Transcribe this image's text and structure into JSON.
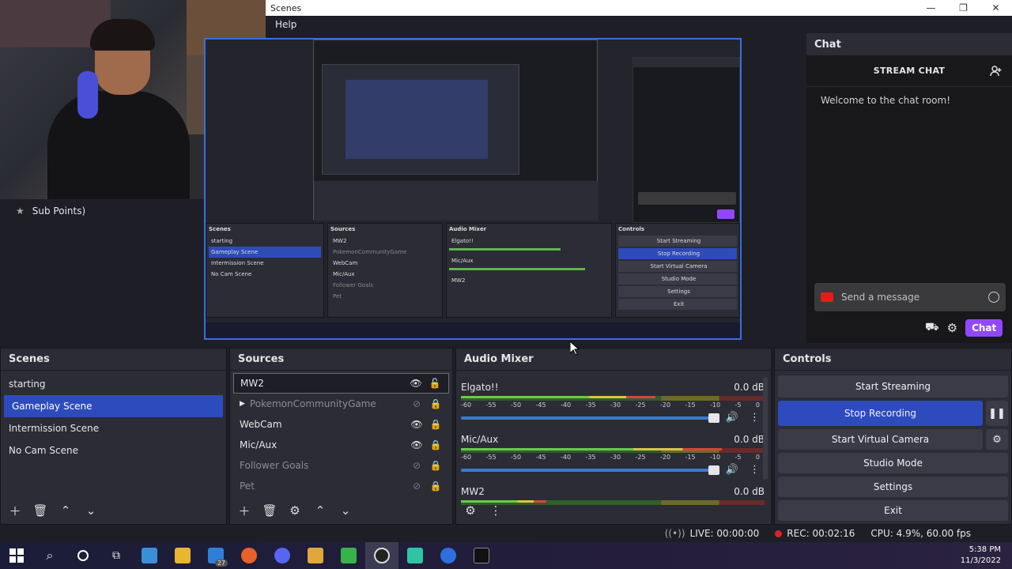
{
  "window": {
    "title": "Scenes",
    "menu_help": "Help"
  },
  "overlay": {
    "sub_points": "Sub Points)"
  },
  "chat": {
    "header": "Chat",
    "title": "STREAM CHAT",
    "welcome": "Welcome to the chat room!",
    "input_placeholder": "Send a message",
    "chat_button": "Chat"
  },
  "scenes": {
    "header": "Scenes",
    "items": [
      "starting",
      "Gameplay Scene",
      "Intermission Scene",
      "No Cam Scene"
    ],
    "selected_index": 1
  },
  "sources": {
    "header": "Sources",
    "items": [
      {
        "name": "MW2",
        "visible": true,
        "locked": false,
        "dim": false
      },
      {
        "name": "PokemonCommunityGame",
        "visible": false,
        "locked": true,
        "dim": true,
        "group": true
      },
      {
        "name": "WebCam",
        "visible": true,
        "locked": true,
        "dim": false
      },
      {
        "name": "Mic/Aux",
        "visible": true,
        "locked": true,
        "dim": false
      },
      {
        "name": "Follower Goals",
        "visible": false,
        "locked": true,
        "dim": true
      },
      {
        "name": "Pet",
        "visible": false,
        "locked": true,
        "dim": true
      }
    ]
  },
  "mixer": {
    "header": "Audio Mixer",
    "scale": [
      "-60",
      "-55",
      "-50",
      "-45",
      "-40",
      "-35",
      "-30",
      "-25",
      "-20",
      "-15",
      "-10",
      "-5",
      "0"
    ],
    "channels": [
      {
        "name": "Elgato!!",
        "db": "0.0 dB",
        "level": 0.64,
        "volume": 1.0
      },
      {
        "name": "Mic/Aux",
        "db": "0.0 dB",
        "level": 0.86,
        "volume": 1.0
      },
      {
        "name": "MW2",
        "db": "0.0 dB",
        "level": 0.28,
        "volume": 1.0
      }
    ]
  },
  "controls": {
    "header": "Controls",
    "start_streaming": "Start Streaming",
    "stop_recording": "Stop Recording",
    "start_virtual_camera": "Start Virtual Camera",
    "studio_mode": "Studio Mode",
    "settings": "Settings",
    "exit": "Exit"
  },
  "status": {
    "live": "LIVE: 00:00:00",
    "rec": "REC: 00:02:16",
    "cpu": "CPU: 4.9%, 60.00 fps"
  },
  "taskbar": {
    "time": "5:38 PM",
    "date": "11/3/2022",
    "mail_badge": "27"
  },
  "colors": {
    "accent_blue": "#2d4bbd",
    "twitch_purple": "#9147ff",
    "rec_red": "#dd2222"
  }
}
